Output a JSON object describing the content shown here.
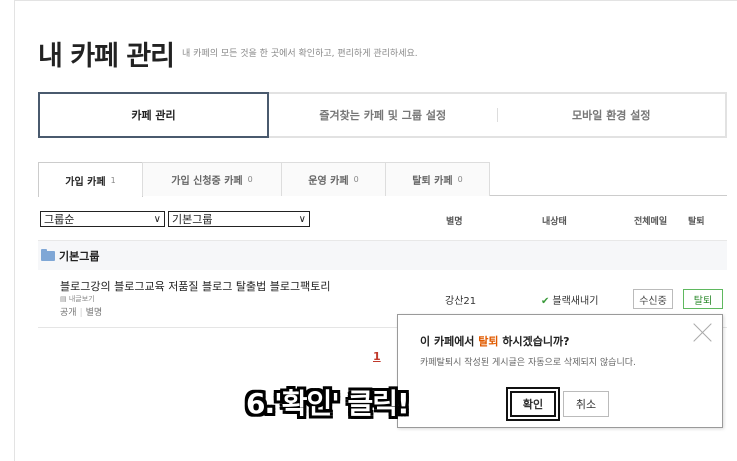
{
  "header": {
    "title": "내 카페 관리",
    "subtitle": "내 카페의 모든 것을 한 곳에서 확인하고, 편리하게 관리하세요."
  },
  "main_tabs": [
    {
      "label": "카페 관리"
    },
    {
      "label": "즐겨찾는 카페 및 그룹 설정"
    },
    {
      "label": "모바일 환경 설정"
    }
  ],
  "sub_tabs": [
    {
      "label": "가입 카페",
      "count": "1"
    },
    {
      "label": "가입 신청중 카페",
      "count": "0"
    },
    {
      "label": "운영 카페",
      "count": "0"
    },
    {
      "label": "탈퇴 카페",
      "count": "0"
    }
  ],
  "filters": {
    "sort": "그룹순",
    "group": "기본그룹"
  },
  "columns": {
    "nickname": "별명",
    "status": "내상태",
    "all_mail": "전체메일",
    "leave": "탈퇴"
  },
  "group": {
    "name": "기본그룹"
  },
  "cafe": {
    "name": "블로그강의 블로그교육 저품질 블로그 탈출법 블로그팩토리",
    "my_posts": "내글보기",
    "visibility": "공개",
    "nick_label": "별명",
    "nickname": "강산21",
    "status": "블랙새내기",
    "receive_btn": "수신중",
    "leave_btn": "탈퇴"
  },
  "pager": {
    "current": "1"
  },
  "popup": {
    "question_pre": "이 카페에서 ",
    "question_hl": "탈퇴",
    "question_post": " 하시겠습니까?",
    "description": "카페탈퇴시 작성된 게시글은 자동으로 삭제되지 않습니다.",
    "ok": "확인",
    "cancel": "취소"
  },
  "annotation": {
    "text": "6.'확인' 클릭!"
  }
}
